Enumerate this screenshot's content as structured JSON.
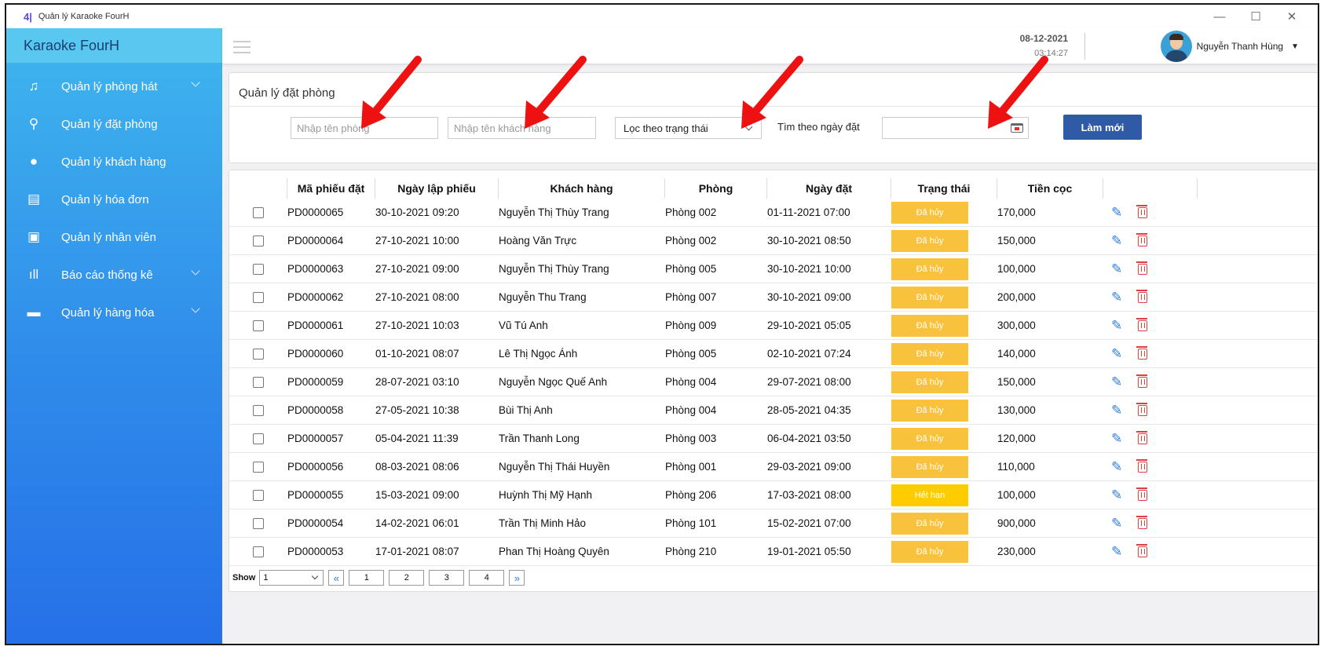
{
  "window": {
    "logo": "4|",
    "title": "Quản lý Karaoke FourH",
    "controls": [
      "—",
      "☐",
      "✕"
    ]
  },
  "sidebar": {
    "brand": "Karaoke FourH",
    "items": [
      {
        "label": "Quản lý phòng hát",
        "icon": "singer-icon",
        "glyph": "♫",
        "expandable": true
      },
      {
        "label": "Quản lý đặt phòng",
        "icon": "booking-icon",
        "glyph": "⚲",
        "expandable": false
      },
      {
        "label": "Quản lý khách hàng",
        "icon": "user-icon",
        "glyph": "●",
        "expandable": false
      },
      {
        "label": "Quản lý hóa đơn",
        "icon": "invoice-icon",
        "glyph": "▤",
        "expandable": false
      },
      {
        "label": "Quản lý nhân viên",
        "icon": "employee-icon",
        "glyph": "▣",
        "expandable": false
      },
      {
        "label": "Báo cáo thống kê",
        "icon": "chart-icon",
        "glyph": "ıll",
        "expandable": true
      },
      {
        "label": "Quản lý hàng hóa",
        "icon": "goods-icon",
        "glyph": "▬",
        "expandable": true
      }
    ]
  },
  "header": {
    "date": "08-12-2021",
    "time": "03:14:27",
    "user_name": "Nguyễn Thanh Hùng",
    "caret": "▼"
  },
  "filter": {
    "title": "Quản lý đặt phòng",
    "room_placeholder": "Nhập tên phòng",
    "customer_placeholder": "Nhập tên khách hàng",
    "status_select": "Lọc theo trạng thái",
    "date_label": "Tìm theo ngày đặt",
    "refresh_label": "Làm mới"
  },
  "colors": {
    "cancelled": "#f9c23c",
    "expired": "#ffcc00",
    "edit": "#2f7de0",
    "delete": "#e04040",
    "arrow": "#ee1111"
  },
  "table": {
    "columns": [
      "",
      "Mã phiếu đặt",
      "Ngày lập phiếu",
      "Khách hàng",
      "Phòng",
      "Ngày đặt",
      "Trạng thái",
      "Tiền cọc",
      ""
    ],
    "rows": [
      {
        "id": "PD0000065",
        "created": "30-10-2021 09:20",
        "customer": "Nguyễn Thị Thùy Trang",
        "room": "Phòng 002",
        "booked": "01-11-2021 07:00",
        "status": "Đã hủy",
        "deposit": "170,000"
      },
      {
        "id": "PD0000064",
        "created": "27-10-2021 10:00",
        "customer": "Hoàng Văn Trực",
        "room": "Phòng 002",
        "booked": "30-10-2021 08:50",
        "status": "Đã hủy",
        "deposit": "150,000"
      },
      {
        "id": "PD0000063",
        "created": "27-10-2021 09:00",
        "customer": "Nguyễn Thị Thùy Trang",
        "room": "Phòng 005",
        "booked": "30-10-2021 10:00",
        "status": "Đã hủy",
        "deposit": "100,000"
      },
      {
        "id": "PD0000062",
        "created": "27-10-2021 08:00",
        "customer": "Nguyễn Thu Trang",
        "room": "Phòng 007",
        "booked": "30-10-2021 09:00",
        "status": "Đã hủy",
        "deposit": "200,000"
      },
      {
        "id": "PD0000061",
        "created": "27-10-2021 10:03",
        "customer": "Vũ Tú Anh",
        "room": "Phòng 009",
        "booked": "29-10-2021 05:05",
        "status": "Đã hủy",
        "deposit": "300,000"
      },
      {
        "id": "PD0000060",
        "created": "01-10-2021 08:07",
        "customer": "Lê Thị Ngọc Ánh",
        "room": "Phòng 005",
        "booked": "02-10-2021 07:24",
        "status": "Đã hủy",
        "deposit": "140,000"
      },
      {
        "id": "PD0000059",
        "created": "28-07-2021 03:10",
        "customer": "Nguyễn Ngọc Quế Anh",
        "room": "Phòng 004",
        "booked": "29-07-2021 08:00",
        "status": "Đã hủy",
        "deposit": "150,000"
      },
      {
        "id": "PD0000058",
        "created": "27-05-2021 10:38",
        "customer": "Bùi Thị Anh",
        "room": "Phòng 004",
        "booked": "28-05-2021 04:35",
        "status": "Đã hủy",
        "deposit": "130,000"
      },
      {
        "id": "PD0000057",
        "created": "05-04-2021 11:39",
        "customer": "Trần Thanh Long",
        "room": "Phòng 003",
        "booked": "06-04-2021 03:50",
        "status": "Đã hủy",
        "deposit": "120,000"
      },
      {
        "id": "PD0000056",
        "created": "08-03-2021 08:06",
        "customer": "Nguyễn Thị Thái Huyền",
        "room": "Phòng 001",
        "booked": "29-03-2021 09:00",
        "status": "Đã hủy",
        "deposit": "110,000"
      },
      {
        "id": "PD0000055",
        "created": "15-03-2021 09:00",
        "customer": "Huỳnh Thị Mỹ Hạnh",
        "room": "Phòng 206",
        "booked": "17-03-2021 08:00",
        "status": "Hết hạn",
        "deposit": "100,000"
      },
      {
        "id": "PD0000054",
        "created": "14-02-2021 06:01",
        "customer": "Trần Thị Minh Hảo",
        "room": "Phòng 101",
        "booked": "15-02-2021 07:00",
        "status": "Đã hủy",
        "deposit": "900,000"
      },
      {
        "id": "PD0000053",
        "created": "17-01-2021 08:07",
        "customer": "Phan Thị Hoàng Quyên",
        "room": "Phòng 210",
        "booked": "19-01-2021 05:50",
        "status": "Đã hủy",
        "deposit": "230,000"
      }
    ]
  },
  "pagination": {
    "show_label": "Show",
    "show_value": "1",
    "first": "«",
    "pages": [
      "1",
      "2",
      "3",
      "4"
    ],
    "last": "»"
  }
}
